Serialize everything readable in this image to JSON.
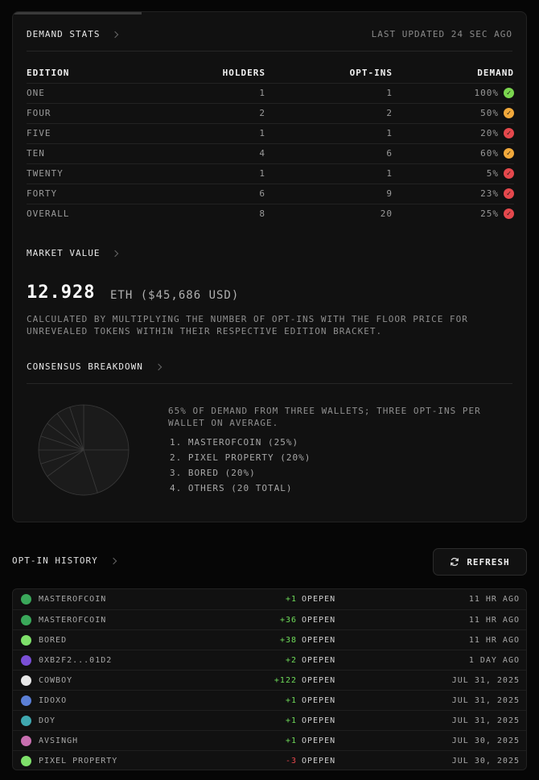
{
  "demand_stats": {
    "title": "Demand Stats",
    "last_updated": "Last updated 24 sec ago",
    "columns": [
      "Edition",
      "Holders",
      "Opt-ins",
      "Demand"
    ],
    "rows": [
      {
        "edition": "One",
        "holders": "1",
        "optins": "1",
        "demand": "100%",
        "status": "green"
      },
      {
        "edition": "Four",
        "holders": "2",
        "optins": "2",
        "demand": "50%",
        "status": "orange"
      },
      {
        "edition": "Five",
        "holders": "1",
        "optins": "1",
        "demand": "20%",
        "status": "red"
      },
      {
        "edition": "Ten",
        "holders": "4",
        "optins": "6",
        "demand": "60%",
        "status": "orange"
      },
      {
        "edition": "Twenty",
        "holders": "1",
        "optins": "1",
        "demand": "5%",
        "status": "red"
      },
      {
        "edition": "Forty",
        "holders": "6",
        "optins": "9",
        "demand": "23%",
        "status": "red"
      },
      {
        "edition": "Overall",
        "holders": "8",
        "optins": "20",
        "demand": "25%",
        "status": "red"
      }
    ],
    "status_colors": {
      "green": "#7bd64f",
      "orange": "#f2a93b",
      "red": "#e5484d"
    }
  },
  "market_value": {
    "title": "Market Value",
    "amount": "12.928",
    "unit": "ETH ($45,686 USD)",
    "description": "Calculated by multiplying the number of opt-ins with the floor price for unrevealed tokens within their respective edition bracket."
  },
  "consensus": {
    "title": "Consensus Breakdown",
    "summary": "65% of demand from three wallets; three opt-ins per wallet on average.",
    "items": [
      "1. MasterofCoin (25%)",
      "2. Pixel Property (20%)",
      "3. Bored (20%)",
      "4. Others (20 total)"
    ],
    "slices": [
      25,
      20,
      20,
      5,
      5,
      5,
      5,
      5,
      5,
      5
    ]
  },
  "history": {
    "title": "Opt-in History",
    "refresh_label": "Refresh",
    "rows": [
      {
        "name": "MasterofCoin",
        "amount": "+1",
        "sign": "pos",
        "collection": "OPEPEN",
        "time": "11 hr ago",
        "avatar": "#3aa85a"
      },
      {
        "name": "MasterofCoin",
        "amount": "+36",
        "sign": "pos",
        "collection": "OPEPEN",
        "time": "11 hr ago",
        "avatar": "#3aa85a"
      },
      {
        "name": "Bored",
        "amount": "+38",
        "sign": "pos",
        "collection": "OPEPEN",
        "time": "11 hr ago",
        "avatar": "#7ee06a"
      },
      {
        "name": "0xb2f2...01d2",
        "amount": "+2",
        "sign": "pos",
        "collection": "OPEPEN",
        "time": "1 day ago",
        "avatar": "#7a4fd6"
      },
      {
        "name": "Cowboy",
        "amount": "+122",
        "sign": "pos",
        "collection": "OPEPEN",
        "time": "Jul 31, 2025",
        "avatar": "#e8e8e8"
      },
      {
        "name": "IDOXO",
        "amount": "+1",
        "sign": "pos",
        "collection": "OPEPEN",
        "time": "Jul 31, 2025",
        "avatar": "#5b7fd6"
      },
      {
        "name": "Doy",
        "amount": "+1",
        "sign": "pos",
        "collection": "OPEPEN",
        "time": "Jul 31, 2025",
        "avatar": "#3fa8b0"
      },
      {
        "name": "avsingh",
        "amount": "+1",
        "sign": "pos",
        "collection": "OPEPEN",
        "time": "Jul 30, 2025",
        "avatar": "#c86fb0"
      },
      {
        "name": "Pixel Property",
        "amount": "-3",
        "sign": "neg",
        "collection": "OPEPEN",
        "time": "Jul 30, 2025",
        "avatar": "#7ee06a"
      }
    ]
  }
}
